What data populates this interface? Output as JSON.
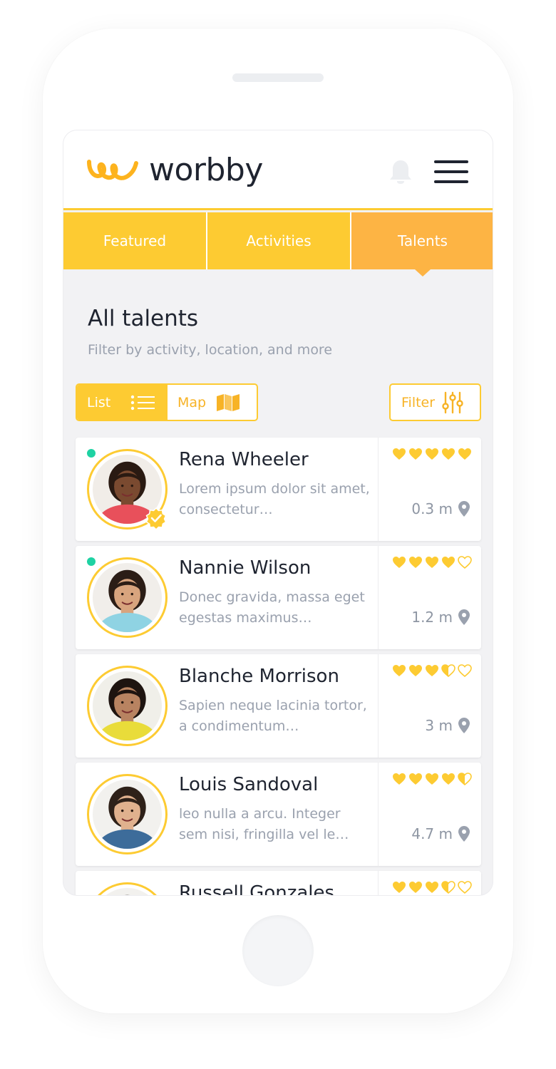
{
  "app": {
    "brand": "worbby"
  },
  "colors": {
    "accent": "#fdcb32",
    "active_tab": "#fdb444",
    "online": "#1ed2a3",
    "text": "#1f2430",
    "muted": "#9aa1ae"
  },
  "header": {
    "notifications_icon": "bell-icon",
    "menu_icon": "hamburger-menu-icon"
  },
  "tabs": [
    {
      "label": "Featured",
      "active": false
    },
    {
      "label": "Activities",
      "active": false
    },
    {
      "label": "Talents",
      "active": true
    }
  ],
  "section": {
    "title": "All talents",
    "subtitle": "Filter by activity, location, and more"
  },
  "view_toggle": {
    "list_label": "List",
    "map_label": "Map",
    "selected": "List"
  },
  "filter": {
    "label": "Filter"
  },
  "talents": [
    {
      "name": "Rena Wheeler",
      "description": "Lorem ipsum dolor sit amet, consectetur…",
      "distance": "0.3 m",
      "rating": 5,
      "online": true,
      "verified": true
    },
    {
      "name": "Nannie Wilson",
      "description": "Donec gravida, massa eget egestas maximus…",
      "distance": "1.2 m",
      "rating": 4,
      "online": true,
      "verified": false
    },
    {
      "name": "Blanche Morrison",
      "description": "Sapien neque lacinia tortor, a condimentum…",
      "distance": "3 m",
      "rating": 3.5,
      "online": false,
      "verified": false
    },
    {
      "name": "Louis Sandoval",
      "description": "leo nulla a arcu. Integer sem nisi, fringilla vel le…",
      "distance": "4.7 m",
      "rating": 4.5,
      "online": false,
      "verified": false
    },
    {
      "name": "Russell Gonzales",
      "description": "",
      "distance": "",
      "rating": 3.5,
      "online": false,
      "verified": false
    }
  ]
}
